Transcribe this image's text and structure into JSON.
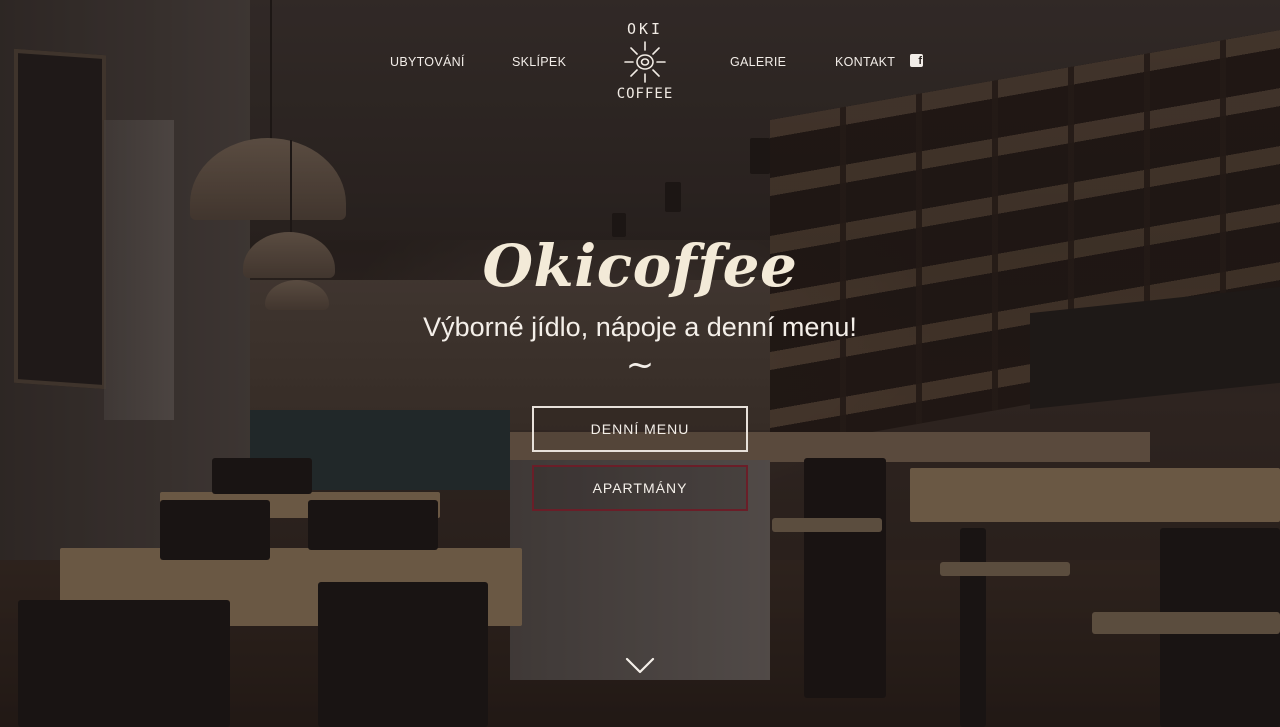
{
  "nav": {
    "left_links": [
      "UBYTOVÁNÍ",
      "SKLÍPEK"
    ],
    "right_links": [
      "GALERIE",
      "KONTAKT"
    ],
    "facebook_icon": "facebook-icon"
  },
  "logo": {
    "top_text": "OKI",
    "bottom_text": "COFFEE"
  },
  "hero": {
    "title": "Okicoffee",
    "subtitle": "Výborné jídlo, nápoje a denní menu!",
    "divider": "~",
    "buttons": {
      "menu": "DENNÍ MENU",
      "apartments": "APARTMÁNY"
    },
    "scroll_icon": "chevron-down-icon"
  },
  "colors": {
    "text": "#f4efe9",
    "title": "#f3ead8",
    "apartments_border": "#6a1e28"
  }
}
